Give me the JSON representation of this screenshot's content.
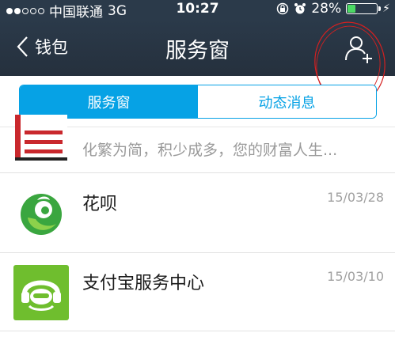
{
  "status_bar": {
    "carrier": "中国联通",
    "network": "3G",
    "time": "10:27",
    "battery": "28%",
    "battery_level": 0.28
  },
  "nav": {
    "back_label": "钱包",
    "title": "服务窗"
  },
  "tabs": [
    {
      "label": "服务窗",
      "active": true
    },
    {
      "label": "动态消息",
      "active": false
    }
  ],
  "list": [
    {
      "title": "",
      "subtitle": "化繁为简，积少成多，您的财富人生...",
      "date": "",
      "icon": "red-building-icon"
    },
    {
      "title": "花呗",
      "subtitle": "",
      "date": "15/03/28",
      "icon": "huabei-leaf-icon"
    },
    {
      "title": "支付宝服务中心",
      "subtitle": "",
      "date": "15/03/10",
      "icon": "headset-service-icon"
    }
  ],
  "colors": {
    "accent": "#06a2e5",
    "nav_bg": "#2b3a4a",
    "annotation": "#d42020"
  }
}
